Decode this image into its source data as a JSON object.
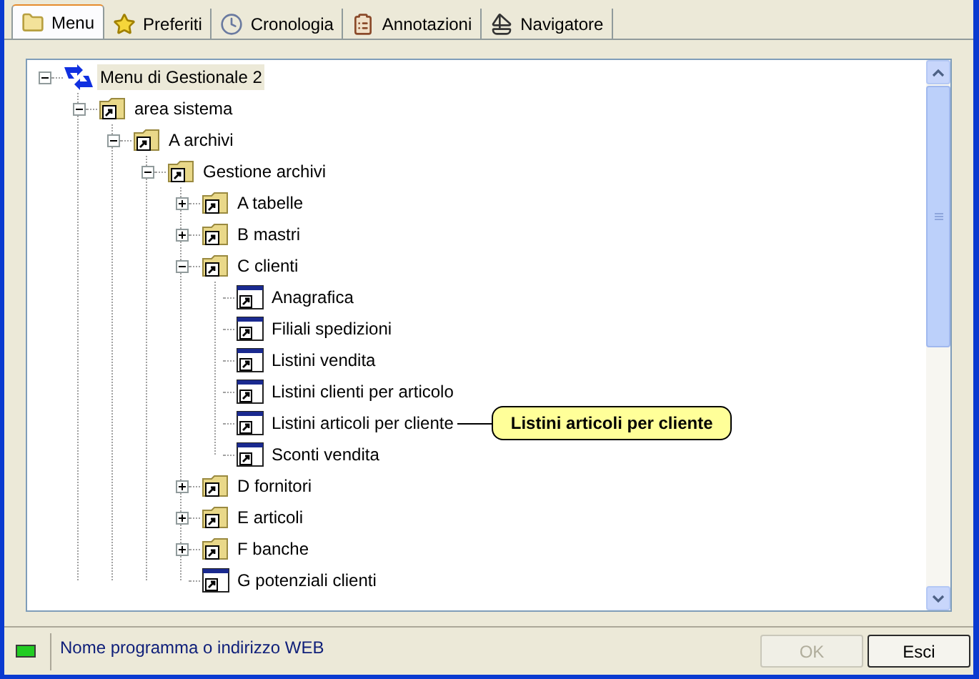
{
  "tabs": [
    {
      "label": "Menu",
      "kind": "folder",
      "selected": true
    },
    {
      "label": "Preferiti",
      "kind": "star",
      "selected": false
    },
    {
      "label": "Cronologia",
      "kind": "clock",
      "selected": false
    },
    {
      "label": "Annotazioni",
      "kind": "clipboard",
      "selected": false
    },
    {
      "label": "Navigatore",
      "kind": "sailboat",
      "selected": false
    }
  ],
  "tree": [
    {
      "label": "Menu di Gestionale 2",
      "kind": "root",
      "selected": true,
      "expanded": true,
      "children": [
        {
          "label": "area sistema",
          "kind": "folder",
          "selected": false,
          "expanded": true,
          "children": [
            {
              "label": "A archivi",
              "kind": "folder",
              "selected": false,
              "expanded": true,
              "children": [
                {
                  "label": "Gestione archivi",
                  "kind": "folder",
                  "selected": false,
                  "expanded": true,
                  "children": [
                    {
                      "label": "A tabelle",
                      "kind": "folder",
                      "selected": false,
                      "expanded": false
                    },
                    {
                      "label": "B mastri",
                      "kind": "folder",
                      "selected": false,
                      "expanded": false
                    },
                    {
                      "label": "C clienti",
                      "kind": "folder",
                      "selected": false,
                      "expanded": true,
                      "children": [
                        {
                          "label": "Anagrafica",
                          "kind": "program",
                          "selected": false
                        },
                        {
                          "label": "Filiali spedizioni",
                          "kind": "program",
                          "selected": false
                        },
                        {
                          "label": "Listini vendita",
                          "kind": "program",
                          "selected": false
                        },
                        {
                          "label": "Listini clienti per articolo",
                          "kind": "program",
                          "selected": false
                        },
                        {
                          "label": "Listini articoli per cliente",
                          "kind": "program",
                          "selected": false,
                          "tooltip": "Listini articoli per cliente"
                        },
                        {
                          "label": "Sconti vendita",
                          "kind": "program",
                          "selected": false
                        }
                      ]
                    },
                    {
                      "label": "D fornitori",
                      "kind": "folder",
                      "selected": false,
                      "expanded": false
                    },
                    {
                      "label": "E articoli",
                      "kind": "folder",
                      "selected": false,
                      "expanded": false
                    },
                    {
                      "label": "F banche",
                      "kind": "folder",
                      "selected": false,
                      "expanded": false
                    },
                    {
                      "label": "G potenziali clienti",
                      "kind": "program",
                      "selected": false
                    }
                  ]
                }
              ]
            }
          ]
        }
      ]
    }
  ],
  "status_bar": {
    "text": "Nome programma o indirizzo WEB"
  },
  "buttons": [
    {
      "label": "OK",
      "disabled": true
    },
    {
      "label": "Esci",
      "disabled": false
    }
  ]
}
